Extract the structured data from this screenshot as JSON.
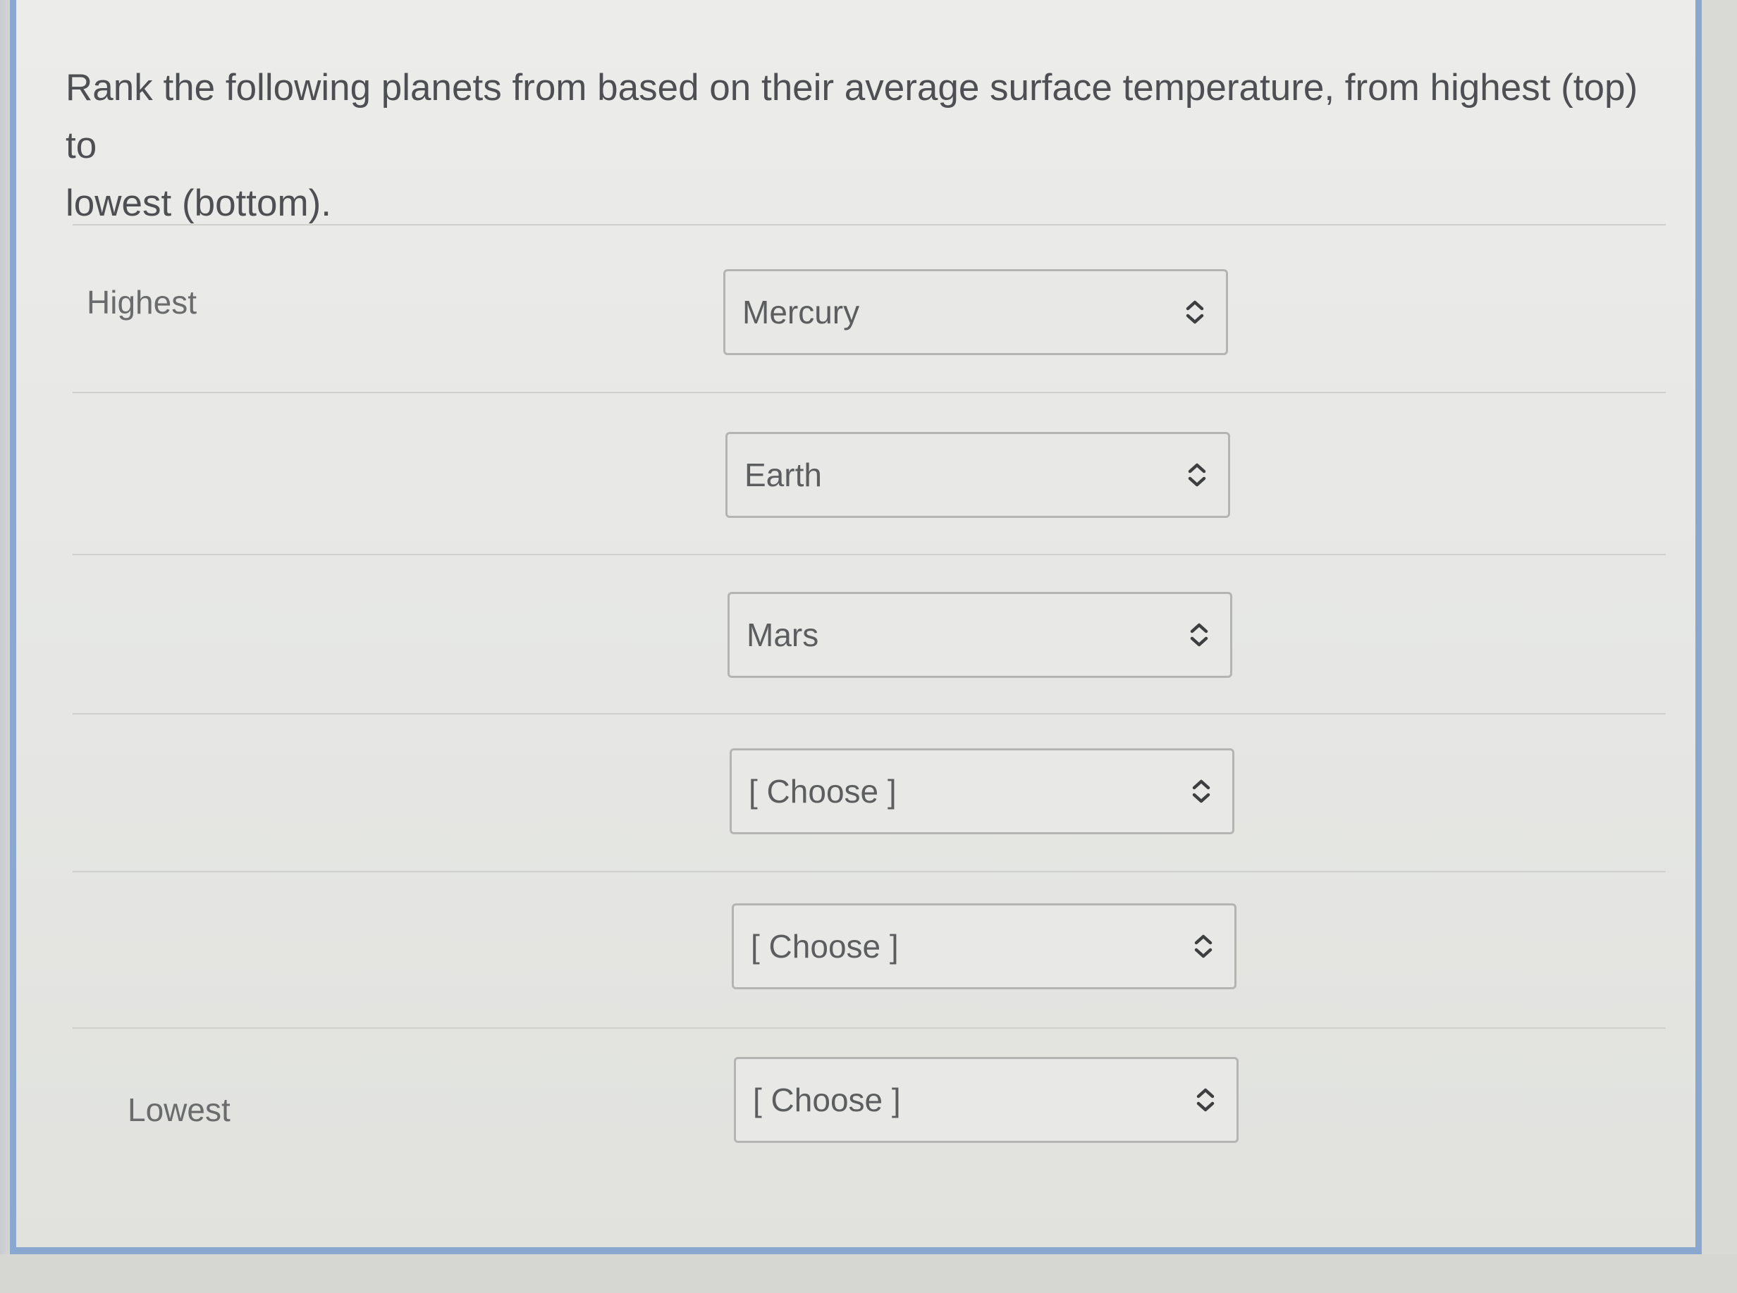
{
  "question": {
    "line1": "Rank the following planets from based on their average surface temperature, from highest (top) to",
    "line2": "lowest (bottom)."
  },
  "labels": {
    "highest": "Highest",
    "lowest": "Lowest"
  },
  "rows": [
    {
      "selected": "Mercury"
    },
    {
      "selected": "Earth"
    },
    {
      "selected": "Mars"
    },
    {
      "selected": "[ Choose ]"
    },
    {
      "selected": "[ Choose ]"
    },
    {
      "selected": "[ Choose ]"
    }
  ],
  "icons": {
    "select_indicator": "chevron-up-down-icon"
  },
  "colors": {
    "panel_border": "#8aa7cf"
  }
}
